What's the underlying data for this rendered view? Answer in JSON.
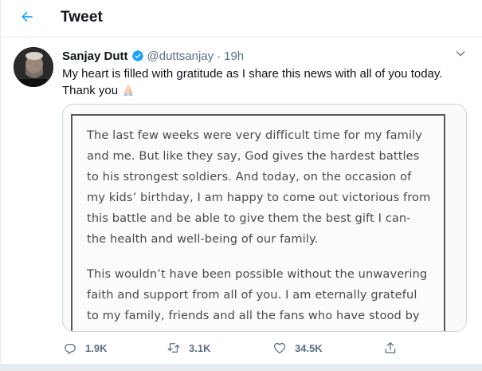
{
  "header": {
    "title": "Tweet",
    "back_icon": "arrow-left-icon"
  },
  "colors": {
    "accent": "#1da1f2",
    "secondary_text": "#5b7083",
    "border": "#e6ecf0"
  },
  "tweet": {
    "author": {
      "display_name": "Sanjay Dutt",
      "handle": "@duttsanjay",
      "verified": true
    },
    "separator": "·",
    "time": "19h",
    "text_lines": [
      "My heart is filled with gratitude as I share this news with all of you today.",
      "Thank you"
    ],
    "emoji": "folded-hands-emoji",
    "media": {
      "paragraphs": [
        [
          "The last few weeks were very difficult time for my family",
          "and me. But like they say, God gives the hardest battles",
          "to his strongest soldiers. And today, on the occasion of",
          "my kids’ birthday, I am happy to come out victorious from",
          "this battle and be able to give them the best gift I can-",
          "the health and well-being of our family."
        ],
        [
          "This wouldn’t have been possible without the unwavering",
          "faith and support from all of you. I am eternally grateful",
          "to my family, friends and all the fans who have stood by"
        ]
      ]
    },
    "actions": {
      "replies": "1.9K",
      "retweets": "3.1K",
      "likes": "34.5K"
    }
  }
}
